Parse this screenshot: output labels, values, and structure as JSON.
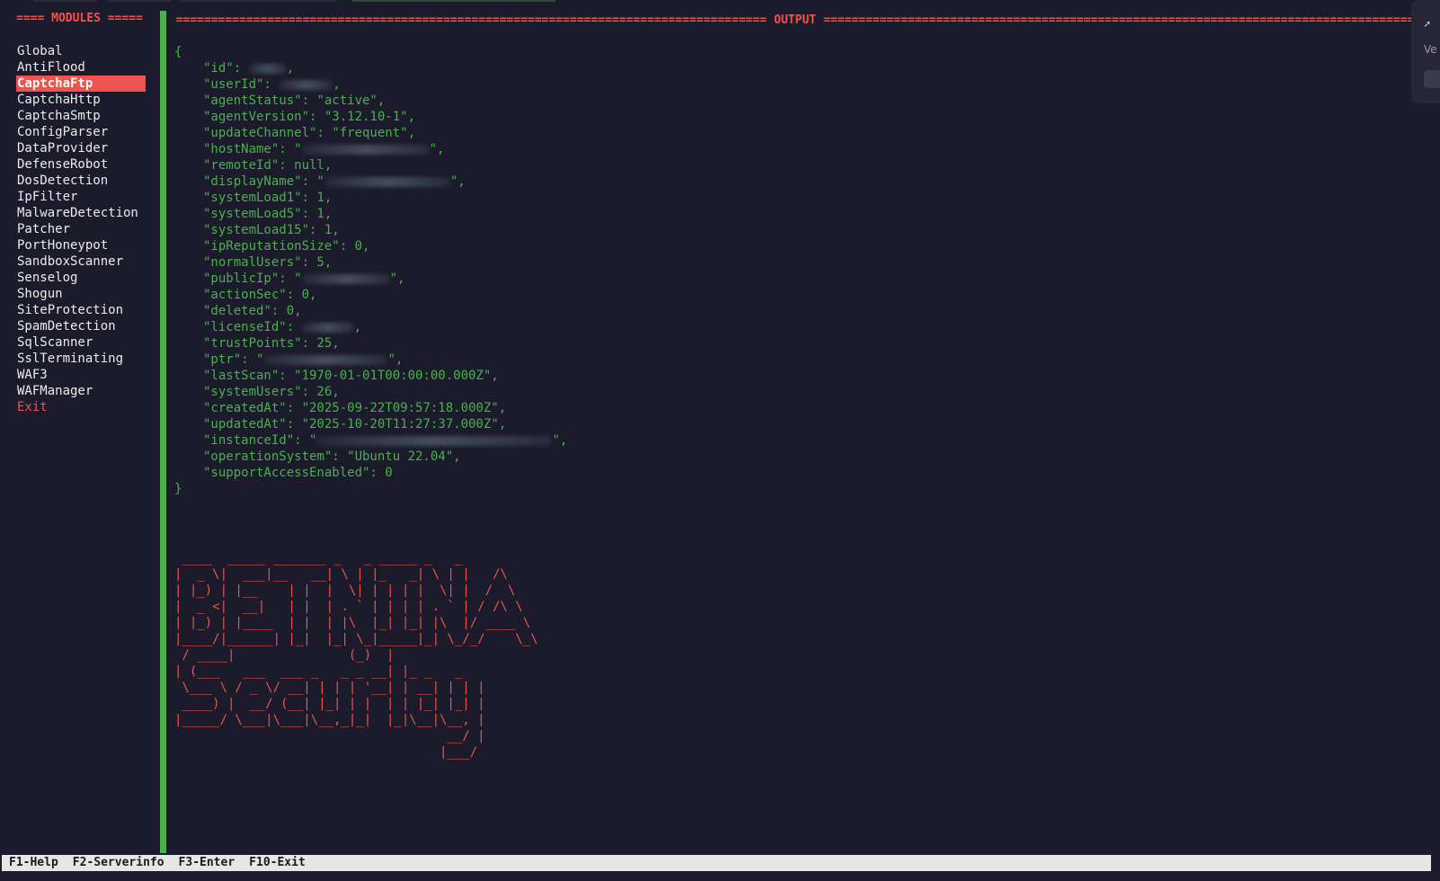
{
  "modules_header": "==== MODULES =====",
  "modules": [
    "Global",
    "AntiFlood",
    "CaptchaFtp",
    "CaptchaHttp",
    "CaptchaSmtp",
    "ConfigParser",
    "DataProvider",
    "DefenseRobot",
    "DosDetection",
    "IpFilter",
    "MalwareDetection",
    "Patcher",
    "PortHoneypot",
    "SandboxScanner",
    "Senselog",
    "Shogun",
    "SiteProtection",
    "SpamDetection",
    "SqlScanner",
    "SslTerminating",
    "WAF3",
    "WAFManager",
    "Exit"
  ],
  "selected_module": "CaptchaFtp",
  "output_header": {
    "title": "OUTPUT",
    "rule": "================================================================================================================================================================================================================"
  },
  "json": {
    "open": "{",
    "close": "}",
    "lines": [
      "\"id\": ",
      "\"userId\": ",
      "\"agentStatus\": \"active\",",
      "\"agentVersion\": \"3.12.10-1\",",
      "\"updateChannel\": \"frequent\",",
      "\"hostName\": \"",
      "\"remoteId\": null,",
      "\"displayName\": \"",
      "\"systemLoad1\": 1,",
      "\"systemLoad5\": 1,",
      "\"systemLoad15\": 1,",
      "\"ipReputationSize\": 0,",
      "\"normalUsers\": 5,",
      "\"publicIp\": \"",
      "\"actionSec\": 0,",
      "\"deleted\": 0,",
      "\"licenseId\": ",
      "\"trustPoints\": 25,",
      "\"ptr\": \"",
      "\"lastScan\": \"1970-01-01T00:00:00.000Z\",",
      "\"systemUsers\": 26,",
      "\"createdAt\": \"2025-09-22T09:57:18.000Z\",",
      "\"updatedAt\": \"2025-10-20T11:27:37.000Z\",",
      "\"instanceId\": \"",
      "\"operationSystem\": \"Ubuntu 22.04\",",
      "\"supportAccessEnabled\": 0"
    ],
    "tails": {
      "0": ",",
      "1": ",",
      "5": "\",",
      "7": "\",",
      "13": "\",",
      "16": ",",
      "18": "\",",
      "23": "\","
    }
  },
  "ascii_art": " ____  _____ _______ _   _ _____ _   _          \n|  _ \\|  ___|__   __| \\ | |_   _| \\ | |   /\\    \n| |_) | |__    | |  |  \\| | | | |  \\| |  /  \\   \n|  _ <|  __|   | |  | . ` | | | | . ` | / /\\ \\  \n| |_) | |____  | |  | |\\  |_| |_| |\\  |/ ____ \\ \n|____/|______| |_|  |_| \\_|_____|_| \\_/_/    \\_\\\n / ____|               (_)  |                   \n| (___   ___  ___ _   _ _ __| |_ _   _           \n \\___ \\ / _ \\/ __| | | | '__| | __| | | |        \n ____) |  __/ (__| |_| | |  | | |_| |_| |        \n|_____/ \\___|\\___|\\__,_|_|  |_|\\__|\\__, |        \n                                    __/ |        \n                                   |___/         ",
  "footer": {
    "f1": "F1-Help",
    "f2": "F2-Serverinfo",
    "f3": "F3-Enter",
    "f10": "F10-Exit"
  },
  "side_panel_text": "Ve"
}
